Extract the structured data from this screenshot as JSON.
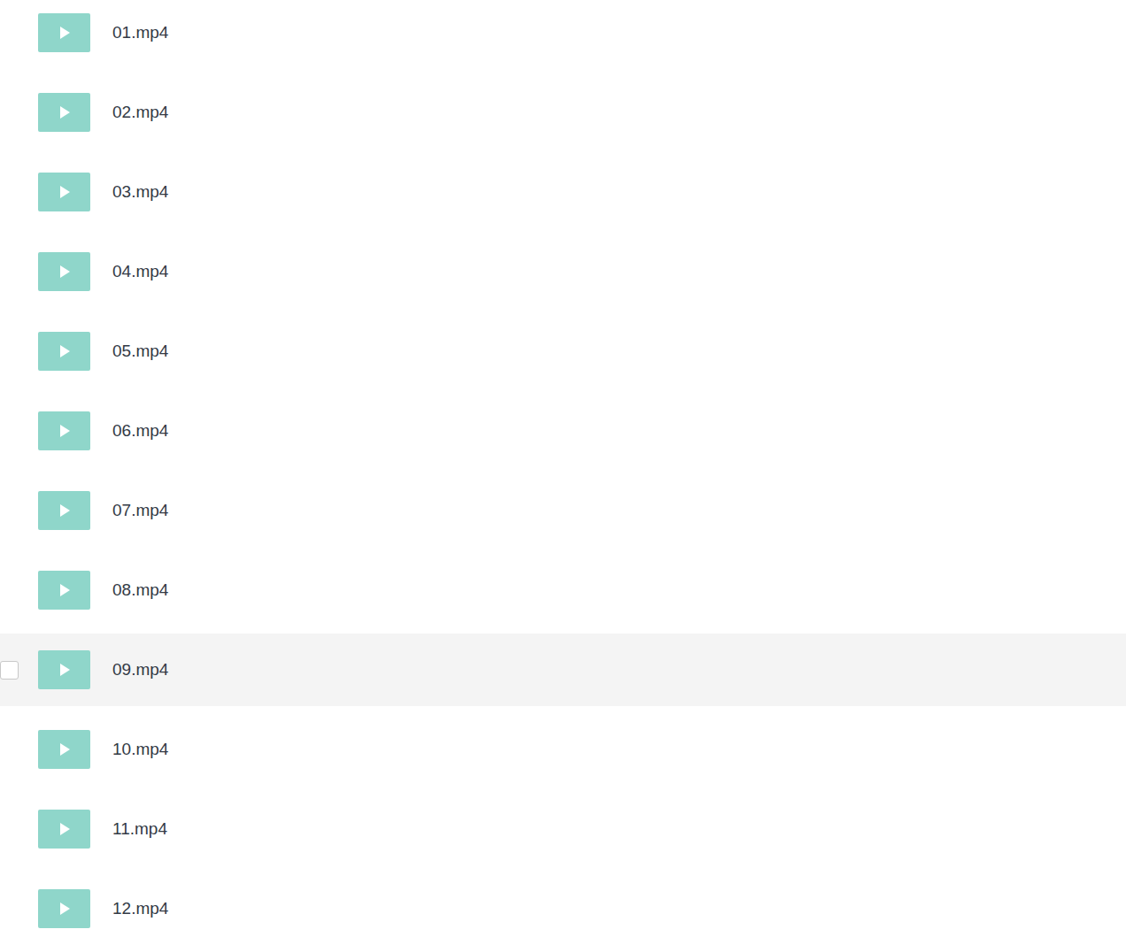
{
  "files": [
    {
      "name": "01.mp4",
      "highlighted": false
    },
    {
      "name": "02.mp4",
      "highlighted": false
    },
    {
      "name": "03.mp4",
      "highlighted": false
    },
    {
      "name": "04.mp4",
      "highlighted": false
    },
    {
      "name": "05.mp4",
      "highlighted": false
    },
    {
      "name": "06.mp4",
      "highlighted": false
    },
    {
      "name": "07.mp4",
      "highlighted": false
    },
    {
      "name": "08.mp4",
      "highlighted": false
    },
    {
      "name": "09.mp4",
      "highlighted": true,
      "checked": false
    },
    {
      "name": "10.mp4",
      "highlighted": false
    },
    {
      "name": "11.mp4",
      "highlighted": false
    },
    {
      "name": "12.mp4",
      "highlighted": false
    }
  ]
}
